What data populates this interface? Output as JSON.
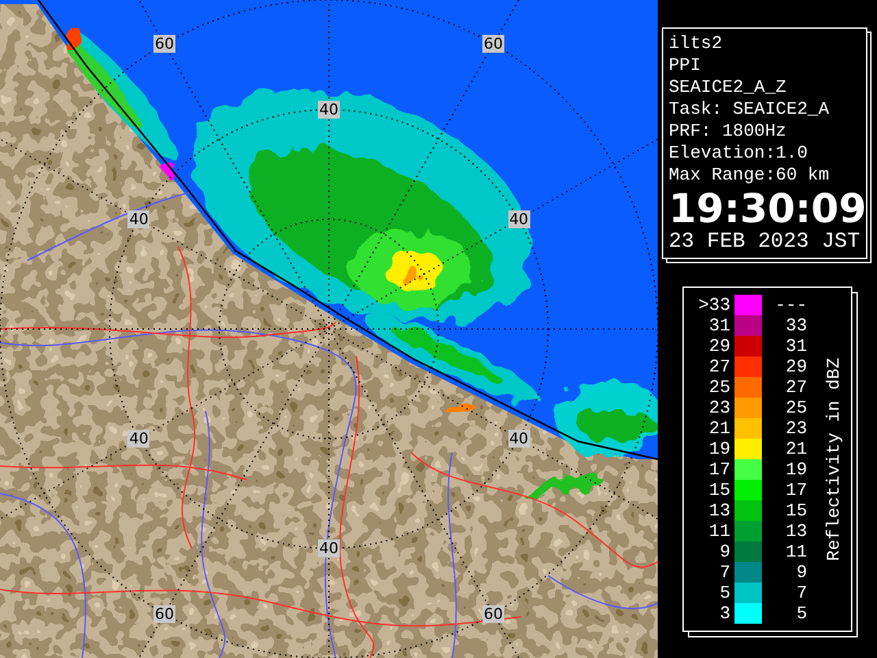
{
  "map": {
    "range_labels": [
      {
        "text": "60"
      },
      {
        "text": "60"
      },
      {
        "text": "40"
      },
      {
        "text": "40"
      },
      {
        "text": "40"
      },
      {
        "text": "40"
      },
      {
        "text": "40"
      },
      {
        "text": "40"
      },
      {
        "text": "60"
      },
      {
        "text": "60"
      }
    ]
  },
  "info_panel": {
    "lines": [
      "ilts2",
      "PPI",
      "SEAICE2_A_Z",
      "Task: SEAICE2_A",
      "PRF: 1800Hz",
      "Elevation:1.0",
      "Max Range:60 km"
    ],
    "time": "19:30:09",
    "date": "23 FEB 2023 JST"
  },
  "legend": {
    "title": "Reflectivity in dBZ",
    "rows": [
      {
        "low": ">33",
        "high": "---",
        "color": "#ff00ff"
      },
      {
        "low": "31",
        "high": "33",
        "color": "#bb0088"
      },
      {
        "low": "29",
        "high": "31",
        "color": "#d00000"
      },
      {
        "low": "27",
        "high": "29",
        "color": "#ff3000"
      },
      {
        "low": "25",
        "high": "27",
        "color": "#ff6a00"
      },
      {
        "low": "23",
        "high": "25",
        "color": "#ff9a00"
      },
      {
        "low": "21",
        "high": "23",
        "color": "#ffc000"
      },
      {
        "low": "19",
        "high": "21",
        "color": "#ffee00"
      },
      {
        "low": "17",
        "high": "19",
        "color": "#44ff44"
      },
      {
        "low": "15",
        "high": "17",
        "color": "#00ee00"
      },
      {
        "low": "13",
        "high": "15",
        "color": "#00c010"
      },
      {
        "low": "11",
        "high": "13",
        "color": "#00a030"
      },
      {
        "low": "9",
        "high": "11",
        "color": "#007a40"
      },
      {
        "low": "7",
        "high": "9",
        "color": "#008888"
      },
      {
        "low": "5",
        "high": "7",
        "color": "#00c4c4"
      },
      {
        "low": "3",
        "high": "5",
        "color": "#00ffff"
      }
    ]
  }
}
